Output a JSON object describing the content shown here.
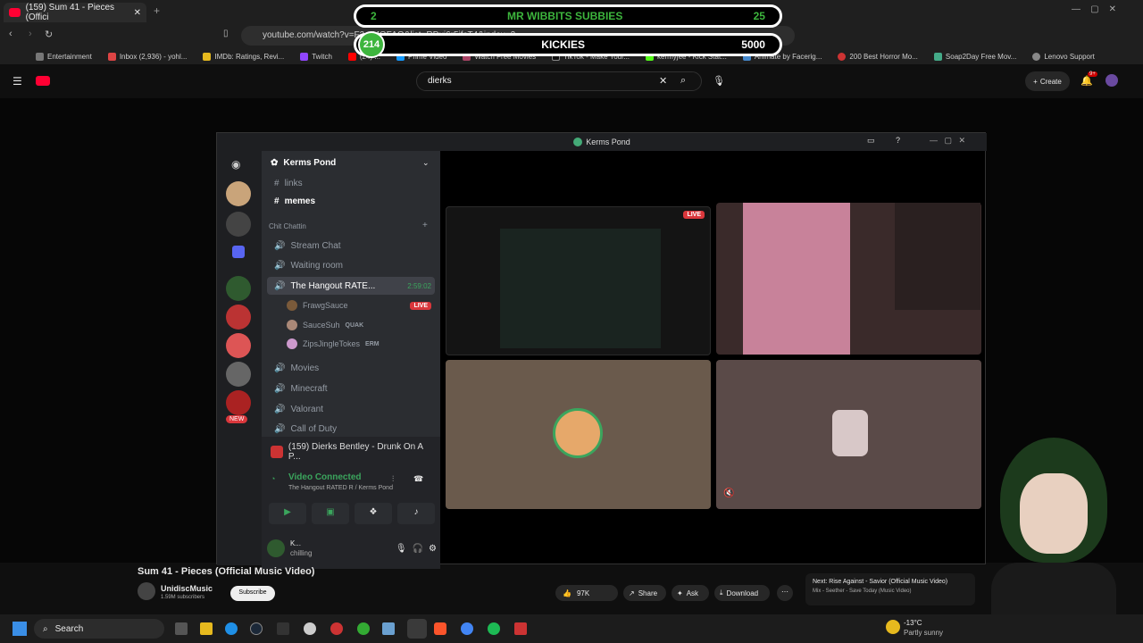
{
  "browser": {
    "tab_title": "(159) Sum 41 - Pieces (Offici",
    "url": "youtube.com/watch?v=F3...MOFAQ&list=RDxj6r5ifcT4&index=2",
    "bookmarks": [
      "Entertainment",
      "Inbox (2,936) - yohl...",
      "IMDb: Ratings, Revi...",
      "Twitch",
      "(24) ...",
      "Prime Video",
      "Watch Free Movies",
      "TikTok - Make Your...",
      "kermyjee - Kick Stat...",
      "Animate by Facerig...",
      "200 Best Horror Mo...",
      "Soap2Day Free Mov...",
      "Lenovo Support"
    ]
  },
  "overlay": {
    "subbies_count": "2",
    "subbies_label": "MR WIBBITS SUBBIES",
    "subbies_goal": "25",
    "kickies_count": "214",
    "kickies_label": "KICKIES",
    "kickies_goal": "5000"
  },
  "youtube": {
    "search_value": "dierks",
    "create_label": "Create",
    "notif_count": "9+",
    "video_title": "Sum 41 - Pieces (Official Music Video)",
    "channel": "UnidiscMusic",
    "subscribers": "1.59M subscribers",
    "subscribe": "Subscribe",
    "likes": "97K",
    "share": "Share",
    "ask": "Ask",
    "download": "Download",
    "next_title": "Next: Rise Against - Savior (Official Music Video)",
    "next_sub": "Mix - Seether - Save Today (Music Video)"
  },
  "discord": {
    "window_title": "Kerms Pond",
    "server_name": "Kerms Pond",
    "channels": {
      "links": "links",
      "memes": "memes",
      "category": "Chit Chattin",
      "stream_chat": "Stream Chat",
      "waiting_room": "Waiting room",
      "hangout": "The Hangout RATE...",
      "hangout_time": "2:59:02",
      "movies": "Movies",
      "minecraft": "Minecraft",
      "valorant": "Valorant",
      "cod": "Call of Duty"
    },
    "users": [
      {
        "name": "FrawgSauce",
        "tag": "LIVE"
      },
      {
        "name": "SauceSuh",
        "tag": "QUAK"
      },
      {
        "name": "ZipsJingleTokes",
        "tag": "ERM"
      }
    ],
    "new_badge": "NEW",
    "activity": "(159) Dierks Bentley - Drunk On A P...",
    "voice_status": "Video Connected",
    "voice_channel": "The Hangout RATED R / Kerms Pond",
    "me_name": "K...",
    "me_status": "chilling",
    "live_badge": "LIVE"
  },
  "taskbar": {
    "search": "Search",
    "weather_temp": "-13°C",
    "weather_desc": "Partly sunny"
  }
}
